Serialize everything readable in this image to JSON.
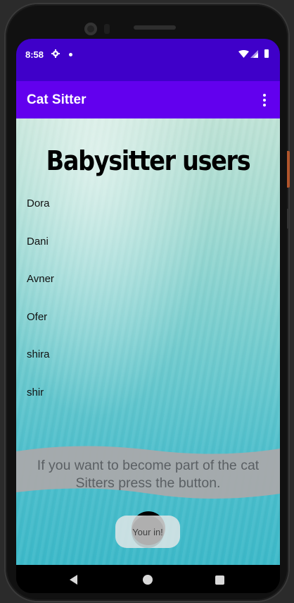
{
  "status_bar": {
    "time": "8:58"
  },
  "app_bar": {
    "title": "Cat Sitter"
  },
  "main": {
    "heading": "Babysitter users",
    "users": [
      "Dora",
      "Dani",
      "Avner",
      "Ofer",
      "shira",
      "shir"
    ],
    "banner_text": "If you want to become part of the cat Sitters press the button.",
    "join_button_label": "Your in!"
  },
  "colors": {
    "status_bar": "#3f00c9",
    "app_bar": "#6200ee",
    "banner": "#a8a8a8"
  },
  "icons": {
    "status": [
      "gear-icon",
      "notification-dot-icon",
      "wifi-icon",
      "signal-icon",
      "battery-icon"
    ],
    "app_bar": [
      "more-vert-icon"
    ],
    "navigation": [
      "back-icon",
      "home-icon",
      "recents-icon"
    ]
  }
}
